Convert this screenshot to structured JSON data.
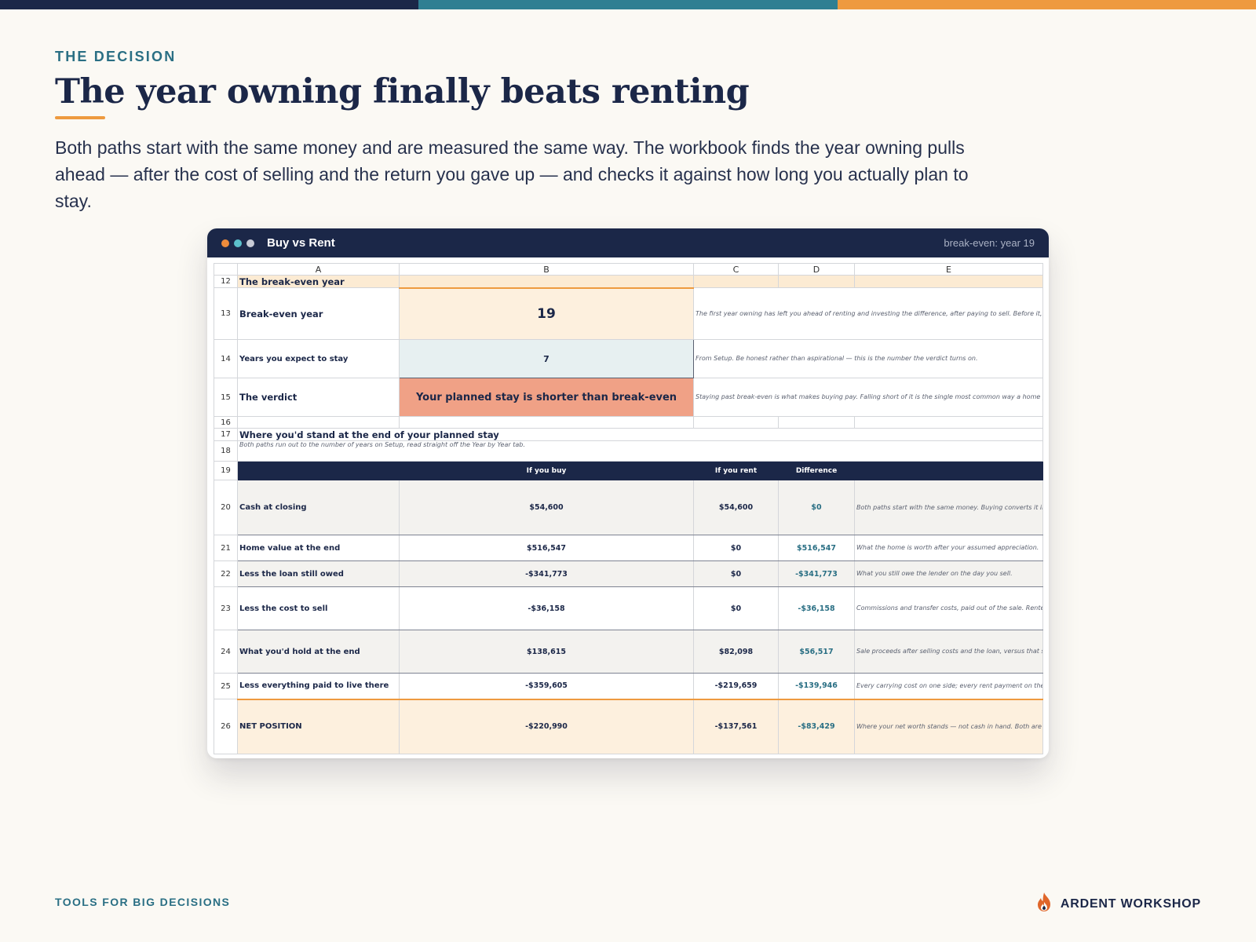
{
  "colors": {
    "navy": "#1b2748",
    "teal": "#2f7f92",
    "orange": "#ee9a3f",
    "verdict": "#f0a186"
  },
  "header": {
    "eyebrow": "THE DECISION",
    "title": "The year owning finally beats renting",
    "lead": "Both paths start with the same money and are measured the same way. The workbook finds the year owning pulls ahead — after the cost of selling and the return you gave up — and checks it against how long you actually plan to stay."
  },
  "window": {
    "title": "Buy vs Rent",
    "status": "break-even: year 19"
  },
  "sheet": {
    "columns": [
      "A",
      "B",
      "C",
      "D",
      "E"
    ],
    "break_even": {
      "row": "12",
      "section_title": "The break-even year",
      "year_row": "13",
      "year_label": "Break-even year",
      "year_value": "19",
      "year_note": "The first year owning has left you ahead of renting and investing the difference, after paying to sell. Before it, selling would leave you behind.",
      "stay_row": "14",
      "stay_label": "Years you expect to stay",
      "stay_value": "7",
      "stay_note": "From Setup. Be honest rather than aspirational — this is the number the verdict turns on.",
      "verdict_row": "15",
      "verdict_label": "The verdict",
      "verdict_value": "Your planned stay is shorter than break-even",
      "verdict_note": "Staying past break-even is what makes buying pay. Falling short of it is the single most common way a home purchase loses money."
    },
    "blank_row": "16",
    "standing": {
      "title_row": "17",
      "title": "Where you'd stand at the end of your planned stay",
      "sub_row": "18",
      "subtitle": "Both paths run out to the number of years on Setup, read straight off the Year by Year tab.",
      "header_row": "19",
      "headers": {
        "buy": "If you buy",
        "rent": "If you rent",
        "diff": "Difference"
      },
      "rows": [
        {
          "n": "20",
          "label": "Cash at closing",
          "buy": "$54,600",
          "rent": "$54,600",
          "diff": "$0",
          "note": "Both paths start with the same money. Buying converts it into equity and spends the closing costs; renting keeps it invested."
        },
        {
          "n": "21",
          "label": "Home value at the end",
          "buy": "$516,547",
          "rent": "$0",
          "diff": "$516,547",
          "note": "What the home is worth after your assumed appreciation."
        },
        {
          "n": "22",
          "label": "Less the loan still owed",
          "buy": "-$341,773",
          "rent": "$0",
          "diff": "-$341,773",
          "note": "What you still owe the lender on the day you sell."
        },
        {
          "n": "23",
          "label": "Less the cost to sell",
          "buy": "-$36,158",
          "rent": "$0",
          "diff": "-$36,158",
          "note": "Commissions and transfer costs, paid out of the sale. Renters never pay this."
        },
        {
          "n": "24",
          "label": "What you'd hold at the end",
          "buy": "$138,615",
          "rent": "$82,098",
          "diff": "$56,517",
          "note": "Sale proceeds after selling costs and the loan, versus that starting cash invested and grown."
        },
        {
          "n": "25",
          "label": "Less everything paid to live there",
          "buy": "-$359,605",
          "rent": "-$219,659",
          "diff": "-$139,946",
          "note": "Every carrying cost on one side; every rent payment on the other."
        },
        {
          "n": "26",
          "label": "NET POSITION",
          "buy": "-$220,990",
          "rent": "-$137,561",
          "diff": "-$83,429",
          "note": "Where your net worth stands — not cash in hand. Both are negative because housing is consumed; only the difference means anything."
        }
      ]
    }
  },
  "footer": {
    "left": "TOOLS FOR BIG DECISIONS",
    "brand": "ARDENT WORKSHOP",
    "brand_icon": "flame-icon"
  }
}
